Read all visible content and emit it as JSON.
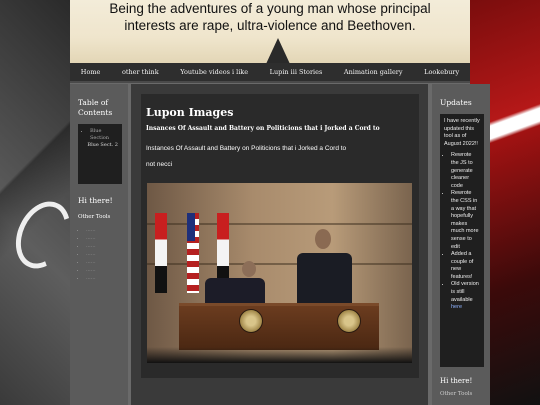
{
  "banner": {
    "text": "Being the adventures of a young man whose principal\ninterests are rape, ultra-violence and  Beethoven."
  },
  "nav": [
    "Home",
    "other think",
    "Youtube videos i like",
    "Lupin iii Stories",
    "Animation gallery",
    "Lookebury"
  ],
  "left_sidebar": {
    "toc_title": "Table of Contents",
    "toc_item": "Blue Section",
    "toc_sub": "Blue Sect. 2",
    "greeting": "Hi there!",
    "tools_title": "Other Tools",
    "tools": [
      "......",
      "......",
      "......",
      "......",
      "......",
      "......",
      "......"
    ]
  },
  "main": {
    "title": "Lupon Images",
    "subtitle": "Insances Of Assault and Battery on Politicions that i Jorked a Cord to",
    "text": "Instances Of Assault and Battery on Politicions that i Jorked a Cord to\nnot necci"
  },
  "right_sidebar": {
    "updates_title": "Updates",
    "updates_intro": "I have recently updated this tool as of August 2022!!",
    "updates_list": [
      "Rewrote the JS to generate cleaner code",
      "Rewrote the CSS in a way that hopefully makes much more sense to edit",
      "Added a couple of new features!",
      "Old version is still available"
    ],
    "updates_link": "here",
    "greeting": "Hi there!",
    "tools_title": "Other Tools"
  }
}
